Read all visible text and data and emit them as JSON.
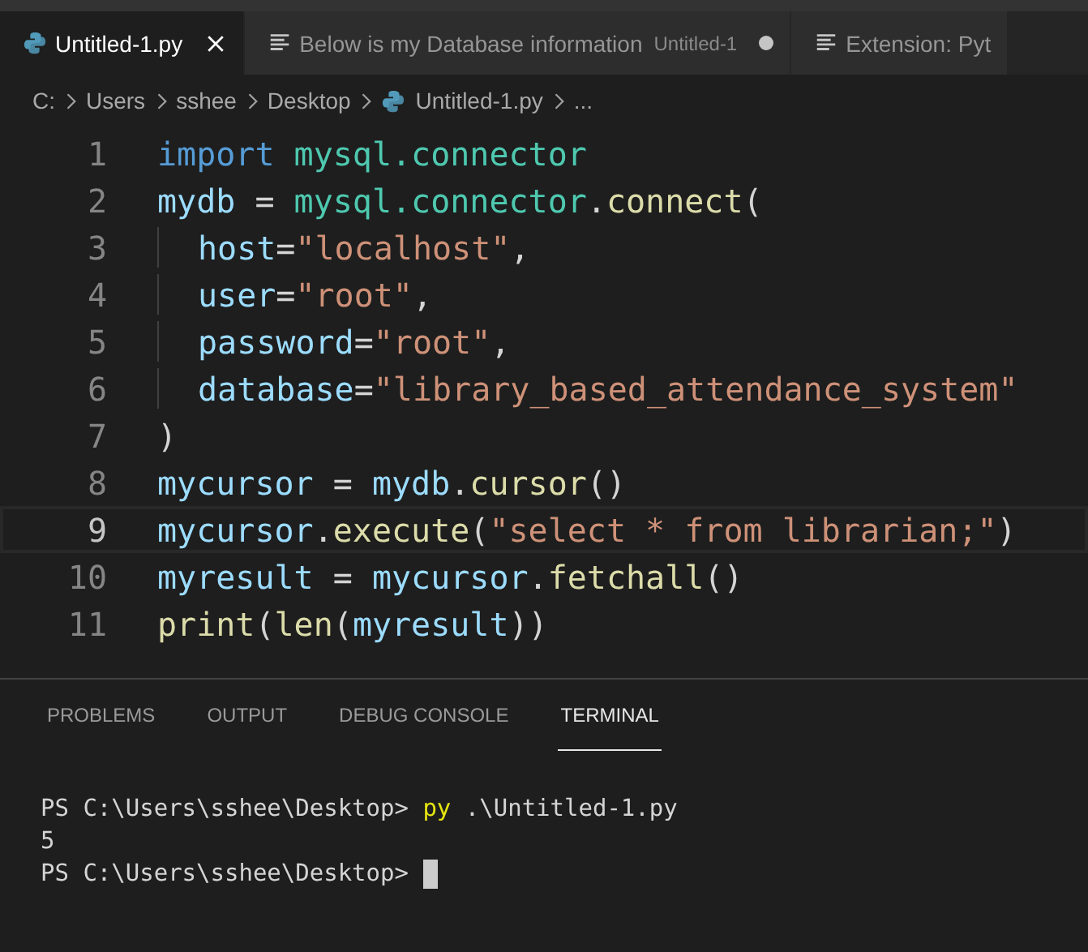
{
  "tabs": [
    {
      "label": "Untitled-1.py",
      "kind": "python",
      "selected": true,
      "closable": true
    },
    {
      "label": "Below is my Database information",
      "kind": "text",
      "description": "Untitled-1",
      "modified": true,
      "selected": false,
      "closable": false
    },
    {
      "label": "Extension: Pyt",
      "kind": "text",
      "selected": false,
      "closable": false
    }
  ],
  "breadcrumb": [
    {
      "label": "C:",
      "kind": "folder"
    },
    {
      "label": "Users",
      "kind": "folder"
    },
    {
      "label": "sshee",
      "kind": "folder"
    },
    {
      "label": "Desktop",
      "kind": "folder"
    },
    {
      "label": "Untitled-1.py",
      "kind": "python"
    },
    {
      "label": "...",
      "kind": "symbol"
    }
  ],
  "code": [
    {
      "number": "1",
      "indent": false,
      "current": false,
      "tokens": [
        {
          "t": "import ",
          "kind": "kw"
        },
        {
          "t": "mysql.connector",
          "kind": "mod"
        }
      ]
    },
    {
      "number": "2",
      "indent": false,
      "current": false,
      "tokens": [
        {
          "t": "mydb",
          "kind": "var"
        },
        {
          "t": " = ",
          "kind": "p"
        },
        {
          "t": "mysql.connector",
          "kind": "mod"
        },
        {
          "t": ".",
          "kind": "p"
        },
        {
          "t": "connect",
          "kind": "fn"
        },
        {
          "t": "(",
          "kind": "p"
        }
      ]
    },
    {
      "number": "3",
      "indent": true,
      "current": false,
      "tokens": [
        {
          "t": "host",
          "kind": "var"
        },
        {
          "t": "=",
          "kind": "p"
        },
        {
          "t": "\"localhost\"",
          "kind": "str"
        },
        {
          "t": ",",
          "kind": "p"
        }
      ]
    },
    {
      "number": "4",
      "indent": true,
      "current": false,
      "tokens": [
        {
          "t": "user",
          "kind": "var"
        },
        {
          "t": "=",
          "kind": "p"
        },
        {
          "t": "\"root\"",
          "kind": "str"
        },
        {
          "t": ",",
          "kind": "p"
        }
      ]
    },
    {
      "number": "5",
      "indent": true,
      "current": false,
      "tokens": [
        {
          "t": "password",
          "kind": "var"
        },
        {
          "t": "=",
          "kind": "p"
        },
        {
          "t": "\"root\"",
          "kind": "str"
        },
        {
          "t": ",",
          "kind": "p"
        }
      ]
    },
    {
      "number": "6",
      "indent": true,
      "current": false,
      "tokens": [
        {
          "t": "database",
          "kind": "var"
        },
        {
          "t": "=",
          "kind": "p"
        },
        {
          "t": "\"library_based_attendance_system\"",
          "kind": "str"
        }
      ]
    },
    {
      "number": "7",
      "indent": false,
      "current": false,
      "tokens": [
        {
          "t": ")",
          "kind": "p"
        }
      ]
    },
    {
      "number": "8",
      "indent": false,
      "current": false,
      "tokens": [
        {
          "t": "mycursor",
          "kind": "var"
        },
        {
          "t": " = ",
          "kind": "p"
        },
        {
          "t": "mydb",
          "kind": "var"
        },
        {
          "t": ".",
          "kind": "p"
        },
        {
          "t": "cursor",
          "kind": "fn"
        },
        {
          "t": "()",
          "kind": "p"
        }
      ]
    },
    {
      "number": "9",
      "indent": false,
      "current": true,
      "tokens": [
        {
          "t": "mycursor",
          "kind": "var"
        },
        {
          "t": ".",
          "kind": "p"
        },
        {
          "t": "execute",
          "kind": "fn"
        },
        {
          "t": "(",
          "kind": "p"
        },
        {
          "t": "\"select * from librarian;\"",
          "kind": "str"
        },
        {
          "t": ")",
          "kind": "p"
        }
      ]
    },
    {
      "number": "10",
      "indent": false,
      "current": false,
      "tokens": [
        {
          "t": "myresult",
          "kind": "var"
        },
        {
          "t": " = ",
          "kind": "p"
        },
        {
          "t": "mycursor",
          "kind": "var"
        },
        {
          "t": ".",
          "kind": "p"
        },
        {
          "t": "fetchall",
          "kind": "fn"
        },
        {
          "t": "()",
          "kind": "p"
        }
      ]
    },
    {
      "number": "11",
      "indent": false,
      "current": false,
      "tokens": [
        {
          "t": "print",
          "kind": "fn"
        },
        {
          "t": "(",
          "kind": "p"
        },
        {
          "t": "len",
          "kind": "fn"
        },
        {
          "t": "(",
          "kind": "p"
        },
        {
          "t": "myresult",
          "kind": "var"
        },
        {
          "t": "))",
          "kind": "p"
        }
      ]
    }
  ],
  "panel_tabs": [
    {
      "label": "PROBLEMS",
      "selected": false
    },
    {
      "label": "OUTPUT",
      "selected": false
    },
    {
      "label": "DEBUG CONSOLE",
      "selected": false
    },
    {
      "label": "TERMINAL",
      "selected": true
    }
  ],
  "terminal": [
    {
      "cursor": false,
      "segments": [
        {
          "t": "PS C:\\Users\\sshee\\Desktop> ",
          "kind": "p"
        },
        {
          "t": "py",
          "kind": "cmd"
        },
        {
          "t": " .\\Untitled-1.py",
          "kind": "p"
        }
      ]
    },
    {
      "cursor": false,
      "segments": [
        {
          "t": "5",
          "kind": "p"
        }
      ]
    },
    {
      "cursor": true,
      "segments": [
        {
          "t": "PS C:\\Users\\sshee\\Desktop> ",
          "kind": "p"
        }
      ]
    }
  ]
}
